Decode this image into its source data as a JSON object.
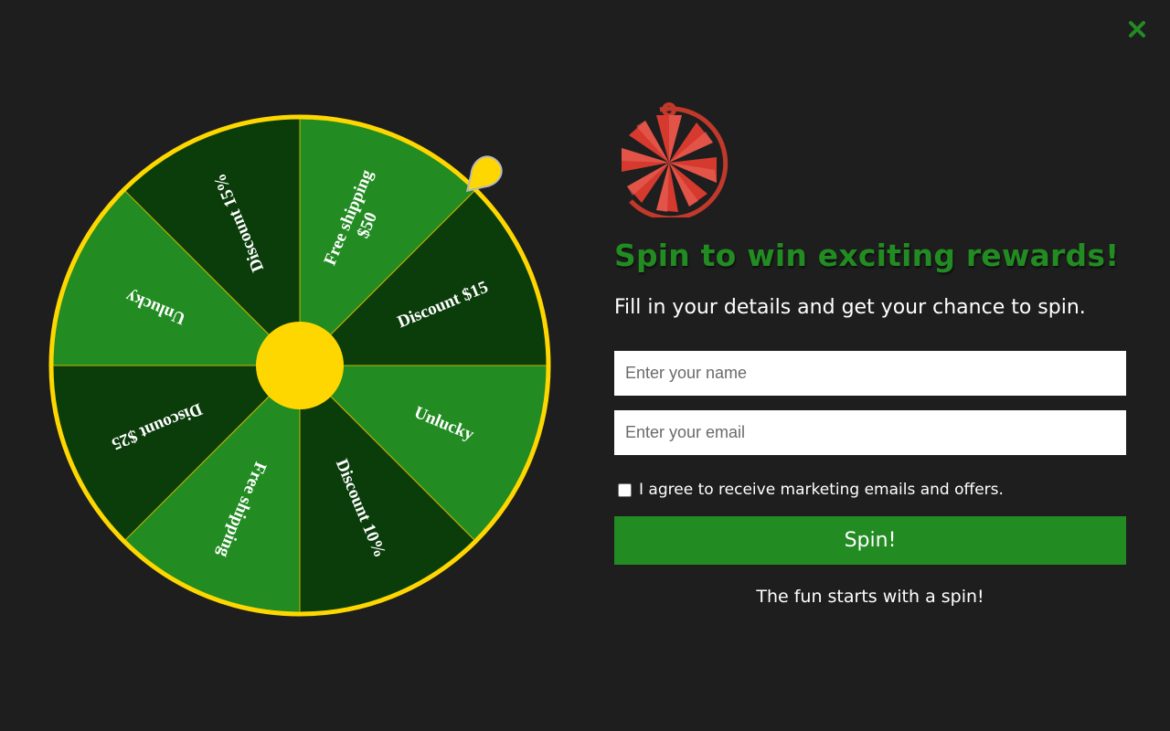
{
  "colors": {
    "background": "#1e1e1e",
    "accent": "#228b22",
    "segment_light": "#228b22",
    "segment_dark": "#0b3d0b",
    "rim": "#ffd700",
    "hub": "#ffd700",
    "logo": "#d63a2f"
  },
  "close": {
    "icon": "close-icon"
  },
  "wheel": {
    "segments": [
      {
        "label": "Free shipping\n$50",
        "shade": "light"
      },
      {
        "label": "Discount $15",
        "shade": "dark"
      },
      {
        "label": "Unlucky",
        "shade": "light"
      },
      {
        "label": "Discount 10%",
        "shade": "dark"
      },
      {
        "label": "Free shipping",
        "shade": "light"
      },
      {
        "label": "Discount $25",
        "shade": "dark"
      },
      {
        "label": "Unlucky",
        "shade": "light"
      },
      {
        "label": "Discount 15%",
        "shade": "dark"
      }
    ],
    "pointer_icon": "pointer-icon",
    "hub_icon": "hub-icon"
  },
  "panel": {
    "logo_icon": "wheel-logo-icon",
    "headline": "Spin to win exciting rewards!",
    "subline": "Fill in your details and get your chance to spin.",
    "name_placeholder": "Enter your name",
    "email_placeholder": "Enter your email",
    "consent_label": "I agree to receive marketing emails and offers.",
    "spin_label": "Spin!",
    "tagline": "The fun starts with a spin!"
  }
}
